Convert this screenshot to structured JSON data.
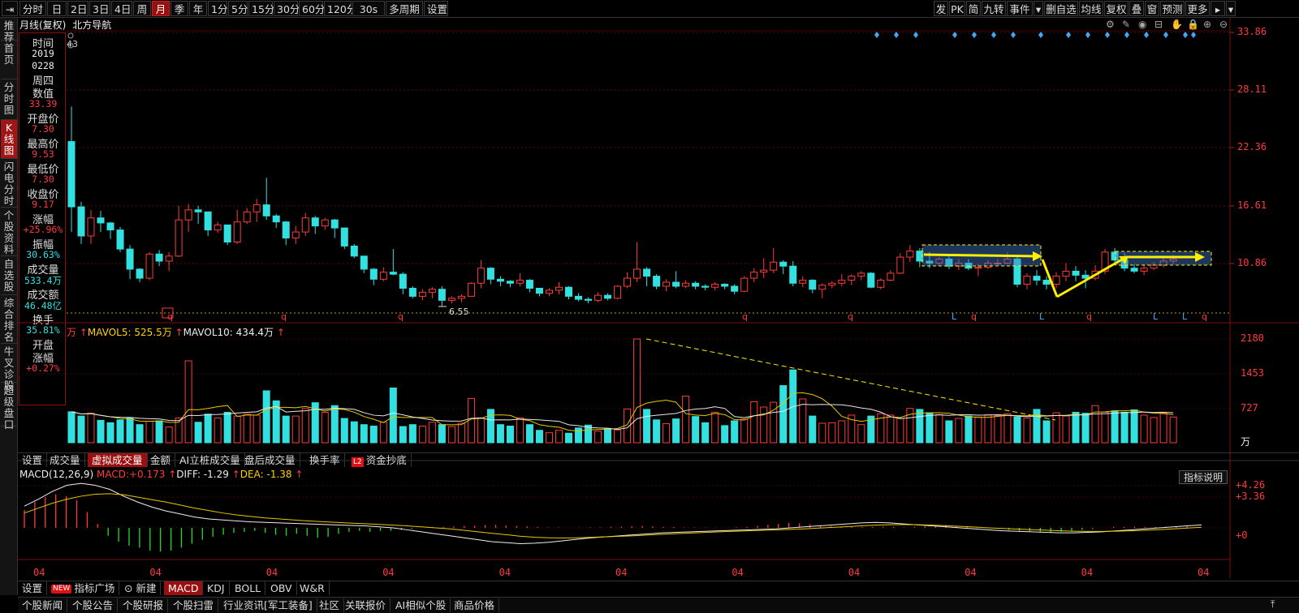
{
  "toolbar": {
    "left_items": [
      "分时",
      "日",
      "2日",
      "3日",
      "4日",
      "周",
      "月",
      "季",
      "年",
      "1分",
      "5分",
      "15分",
      "30分",
      "60分",
      "120分",
      "30s",
      "多周期",
      "设置"
    ],
    "active_item": "月",
    "right_items": [
      "发",
      "PK",
      "简",
      "九转",
      "事件",
      "▾",
      "删自选",
      "均线",
      "复权",
      "叠",
      "窗",
      "预测",
      "更多",
      "▸",
      "▾"
    ]
  },
  "sidebar": {
    "tabs": [
      "推荐",
      "首页",
      "分时图",
      "K线图",
      "闪电分时",
      "个股资料",
      "自选股",
      "综合排名",
      "牛叉诊股",
      "超级盘口"
    ],
    "active": "K线图"
  },
  "chart_header": {
    "period_label": "月线(复权)",
    "stock_name": "北方导航",
    "badge_value": "43"
  },
  "info_panel": {
    "rows": [
      {
        "label": "时间",
        "values": [
          "2019",
          "0228"
        ]
      },
      {
        "label": "周四",
        "values": []
      },
      {
        "label": "数值",
        "values": [
          "33.39"
        ],
        "color": "red"
      },
      {
        "label": "开盘价",
        "values": [
          "7.30"
        ],
        "color": "red"
      },
      {
        "label": "最高价",
        "values": [
          "9.53"
        ],
        "color": "red"
      },
      {
        "label": "最低价",
        "values": [
          "7.30"
        ],
        "color": "red"
      },
      {
        "label": "收盘价",
        "values": [
          "9.17"
        ],
        "color": "red"
      },
      {
        "label": "涨幅",
        "values": [
          "+25.96%"
        ],
        "color": "red"
      },
      {
        "label": "振幅",
        "values": [
          "30.63%"
        ],
        "color": "cyan"
      },
      {
        "label": "成交量",
        "values": [
          "533.4万"
        ],
        "color": "cyan"
      },
      {
        "label": "成交额",
        "values": [
          "46.48亿"
        ],
        "color": "cyan"
      },
      {
        "label": "换手",
        "values": [
          "35.81%"
        ],
        "color": "cyan"
      },
      {
        "label": "开盘",
        "values": []
      },
      {
        "label": "涨幅",
        "values": [
          "+0.27%"
        ],
        "color": "red"
      }
    ]
  },
  "price_axis": [
    "33.86",
    "28.11",
    "22.36",
    "16.61",
    "10.86"
  ],
  "price_low_marker": "6.55",
  "volume_header": {
    "unit": "万",
    "mavol5_label": "MAVOL5:",
    "mavol5_value": "525.5万",
    "mavol10_label": "MAVOL10:",
    "mavol10_value": "434.4万"
  },
  "volume_axis": [
    "2180",
    "1453",
    "727"
  ],
  "volume_unit": "万",
  "volume_tabs": [
    "设置",
    "成交量",
    "虚拟成交量",
    "金额",
    "AI立桩成交量",
    "盘后成交量",
    "换手率",
    "资金抄底"
  ],
  "volume_tabs_active": "虚拟成交量",
  "volume_l2_badge": "L2",
  "macd_header": {
    "name": "MACD(12,26,9)",
    "macd_label": "MACD:",
    "macd_value": "+0.173",
    "diff_label": "DIFF:",
    "diff_value": "-1.29",
    "dea_label": "DEA:",
    "dea_value": "-1.38"
  },
  "macd_explain": "指标说明",
  "macd_axis": [
    "+4.26",
    "+3.36",
    "+0"
  ],
  "x_axis_labels": [
    "04",
    "04",
    "04",
    "04",
    "04",
    "04",
    "04",
    "04",
    "04",
    "04",
    "04"
  ],
  "indicator_tabs": {
    "settings": "设置",
    "new_badge": "NEW",
    "plaza": "指标广场",
    "new": "新建",
    "items": [
      "MACD",
      "KDJ",
      "BOLL",
      "OBV",
      "W&R"
    ],
    "active": "MACD"
  },
  "bottom_nav": [
    "个股新闻",
    "个股公告",
    "个股研报",
    "个股扫雷",
    "行业资讯[军工装备]",
    "社区",
    "关联报价",
    "AI相似个股",
    "商品价格"
  ],
  "colors": {
    "up": "#ff3b3b",
    "down": "#33e0e0",
    "accent": "#9a1010",
    "annotation": "#ffee00"
  }
}
